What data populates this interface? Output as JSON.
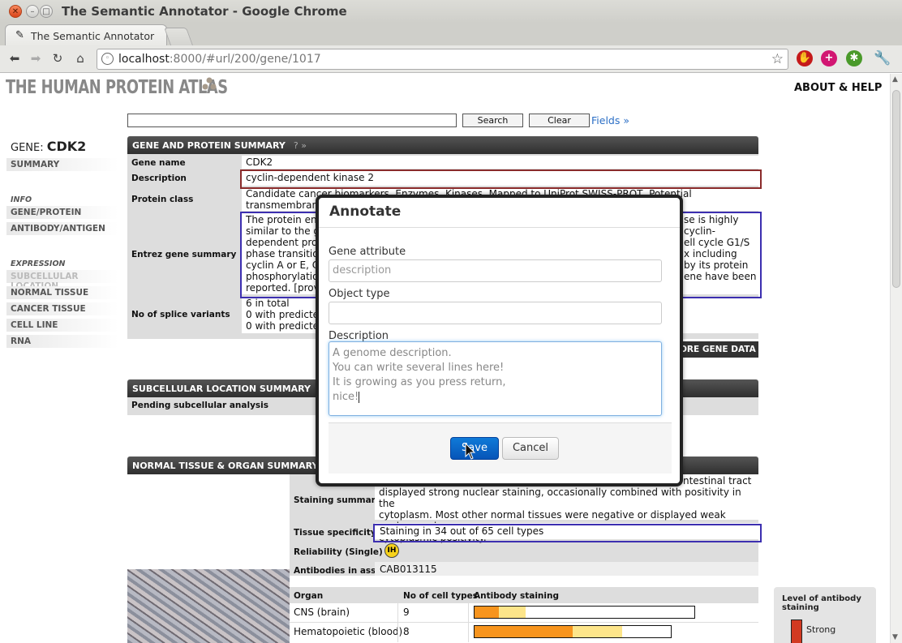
{
  "window": {
    "title": "The Semantic Annotator - Google Chrome"
  },
  "tab": {
    "title": "The Semantic Annotator"
  },
  "url": {
    "host": "localhost",
    "path": ":8000/#url/200/gene/1017"
  },
  "site": {
    "logo": "THE HUMAN PROTEIN ATLAS",
    "about": "ABOUT & HELP"
  },
  "search": {
    "search_label": "Search",
    "clear_label": "Clear",
    "fields_label": "Fields »"
  },
  "sidebar": {
    "gene_prefix": "GENE:",
    "gene_name": "CDK2",
    "summary": "SUMMARY",
    "info_head": "INFO",
    "info_items": [
      "GENE/PROTEIN",
      "ANTIBODY/ANTIGEN"
    ],
    "expr_head": "EXPRESSION",
    "expr_items": [
      "SUBCELLULAR LOCATION",
      "NORMAL TISSUE",
      "CANCER TISSUE",
      "CELL LINE",
      "RNA"
    ]
  },
  "gene_panel": {
    "title": "GENE AND PROTEIN SUMMARY",
    "q": "? »",
    "rows": {
      "gene_name_label": "Gene name",
      "gene_name": "CDK2",
      "description_label": "Description",
      "description": "cyclin-dependent kinase 2",
      "protein_class_label": "Protein class",
      "protein_class": "Candidate cancer biomarkers, Enzymes, Kinases, Mapped to UniProt SWISS-PROT, Potential transmembrane proteins",
      "entrez_label": "Entrez gene summary",
      "entrez_lines": [
        "The protein enc",
        "similar to the ge",
        "dependent prote",
        "phase transition",
        "cyclin A or E, CD",
        "phosphorylation",
        "reported. [provid"
      ],
      "entrez_right": [
        "se is highly",
        "cyclin-",
        "ell cycle G1/S",
        "x including",
        "by its protein",
        "ene have been"
      ],
      "splice_label": "No of splice variants",
      "splice_lines": [
        "6 in total",
        "0 with predicted",
        "0 with predicted"
      ]
    },
    "more": "ORE GENE DATA"
  },
  "subcell_panel": {
    "title": "SUBCELLULAR LOCATION SUMMARY",
    "q": "? »",
    "text": "Pending subcellular analysis"
  },
  "tissue_panel": {
    "title": "NORMAL TISSUE & ORGAN SUMMARY",
    "q": "? »",
    "staining_label": "Staining summary",
    "staining_lines": [
      "displayed strong nuclear staining, occasionally combined with positivity in the",
      "cytoplasm. Most other normal tissues were negative or displayed weak nuclear and",
      "cytoplasmic positivity."
    ],
    "staining_top_right": "ntestinal tract",
    "specificity_label": "Tissue specificity",
    "specificity": "Staining in 34 out of 65 cell types",
    "reliability_label": "Reliability (Single)",
    "reliability_badge": "IH",
    "antibodies_label": "Antibodies in assay",
    "antibodies": "CAB013115",
    "table_headers": [
      "Organ",
      "No of cell types",
      "Antibody staining"
    ],
    "table_rows": [
      {
        "organ": "CNS (brain)",
        "count": "9",
        "strong": 0.11,
        "moderate": 0.12
      },
      {
        "organ": "Hematopoietic (blood)",
        "count": "8",
        "strong": 0.5,
        "moderate": 0.25
      }
    ]
  },
  "legend": {
    "title": "Level of antibody staining",
    "strong": "Strong"
  },
  "modal": {
    "title": "Annotate",
    "gene_attr_label": "Gene attribute",
    "gene_attr_placeholder": "description",
    "object_type_label": "Object type",
    "object_type_value": "",
    "description_label": "Description",
    "description_lines": [
      "A genome description.",
      "You can write several lines here!",
      "It is growing as you press return,",
      "nice!"
    ],
    "save": "Save",
    "cancel": "Cancel"
  },
  "colors": {
    "strong": "#f7941d",
    "moderate": "#fde58a",
    "accent_blue": "#0755b8"
  }
}
